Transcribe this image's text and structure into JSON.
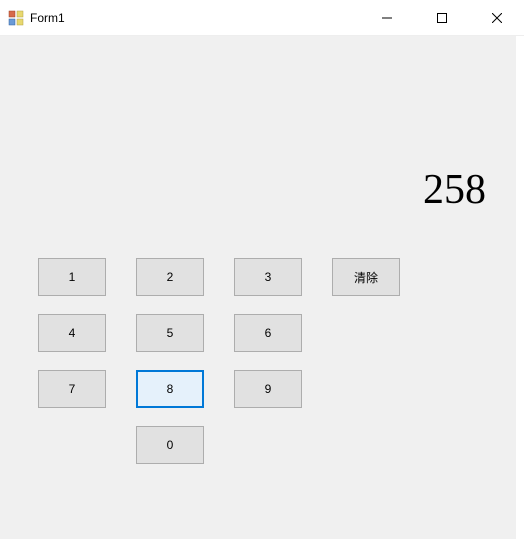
{
  "window": {
    "title": "Form1"
  },
  "display": {
    "value": "258"
  },
  "buttons": {
    "b1": "1",
    "b2": "2",
    "b3": "3",
    "b4": "4",
    "b5": "5",
    "b6": "6",
    "b7": "7",
    "b8": "8",
    "b9": "9",
    "b0": "0",
    "clear": "清除"
  }
}
